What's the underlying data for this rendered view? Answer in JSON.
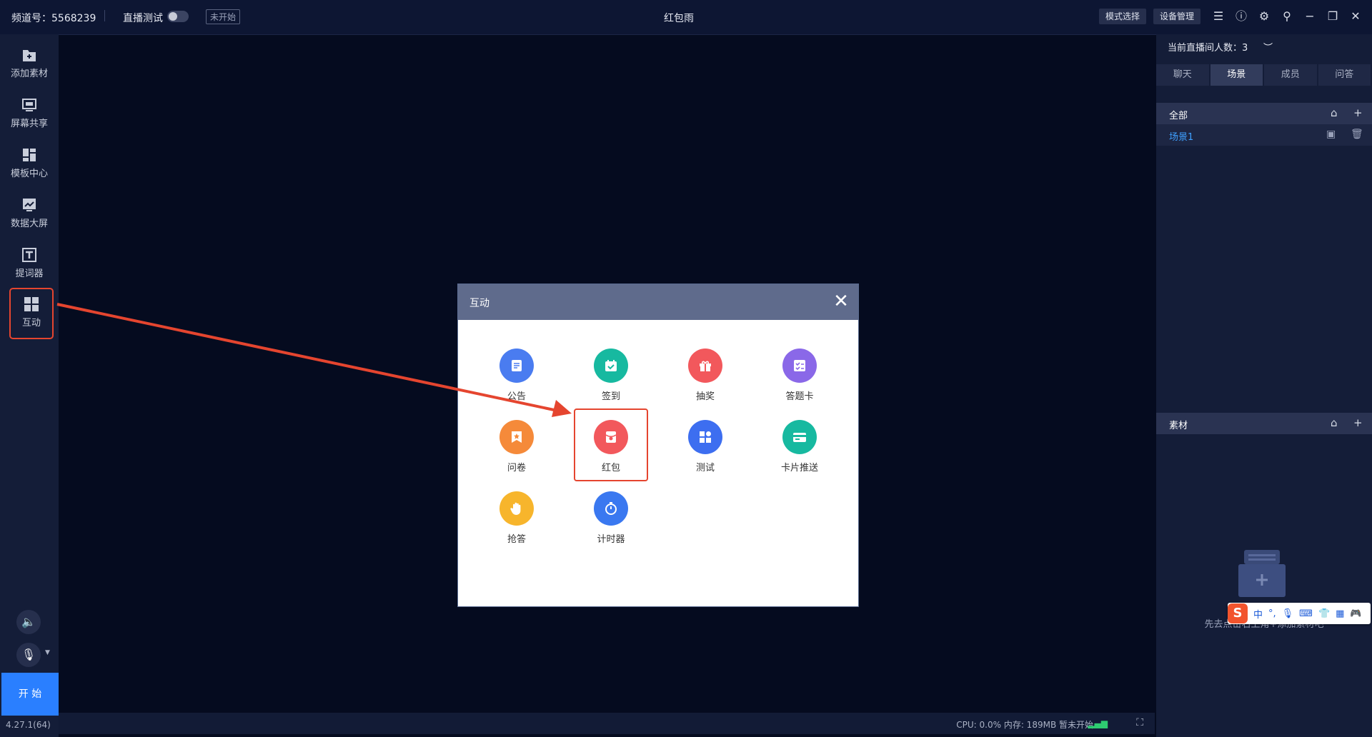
{
  "topbar": {
    "channel": "频道号：5568239",
    "test_label": "直播测试",
    "status": "未开始",
    "title": "红包雨",
    "mode_button": "模式选择",
    "device_button": "设备管理"
  },
  "sidebar": {
    "items": [
      {
        "label": "添加素材",
        "icon": "add-folder-icon"
      },
      {
        "label": "屏幕共享",
        "icon": "monitor-icon"
      },
      {
        "label": "模板中心",
        "icon": "template-icon"
      },
      {
        "label": "数据大屏",
        "icon": "chart-icon"
      },
      {
        "label": "提词器",
        "icon": "text-icon"
      },
      {
        "label": "互动",
        "icon": "grid-icon"
      }
    ],
    "start_label": "开 始",
    "version": "4.27.1(64)"
  },
  "statusbar": {
    "text": "CPU: 0.0%  内存: 189MB  暂未开始"
  },
  "right_panel": {
    "viewers": "当前直播间人数：3",
    "tabs": [
      "聊天",
      "场景",
      "成员",
      "问答"
    ],
    "active_tab": "场景",
    "scene_header": "全部",
    "scene_item": "场景1",
    "material_header": "素材",
    "empty_text": "先去点击右上角+添加素材吧"
  },
  "ime": {
    "logo": "S",
    "mode": "中"
  },
  "modal": {
    "title": "互动",
    "items": [
      {
        "label": "公告",
        "color": "#4a7cf0"
      },
      {
        "label": "签到",
        "color": "#17b9a0"
      },
      {
        "label": "抽奖",
        "color": "#f2585c"
      },
      {
        "label": "答题卡",
        "color": "#8a68e8"
      },
      {
        "label": "问卷",
        "color": "#f58a3a"
      },
      {
        "label": "红包",
        "color": "#f2585c"
      },
      {
        "label": "测试",
        "color": "#3d6ef0"
      },
      {
        "label": "卡片推送",
        "color": "#17b9a0"
      },
      {
        "label": "抢答",
        "color": "#f7b52c"
      },
      {
        "label": "计时器",
        "color": "#3a78f0"
      }
    ]
  }
}
